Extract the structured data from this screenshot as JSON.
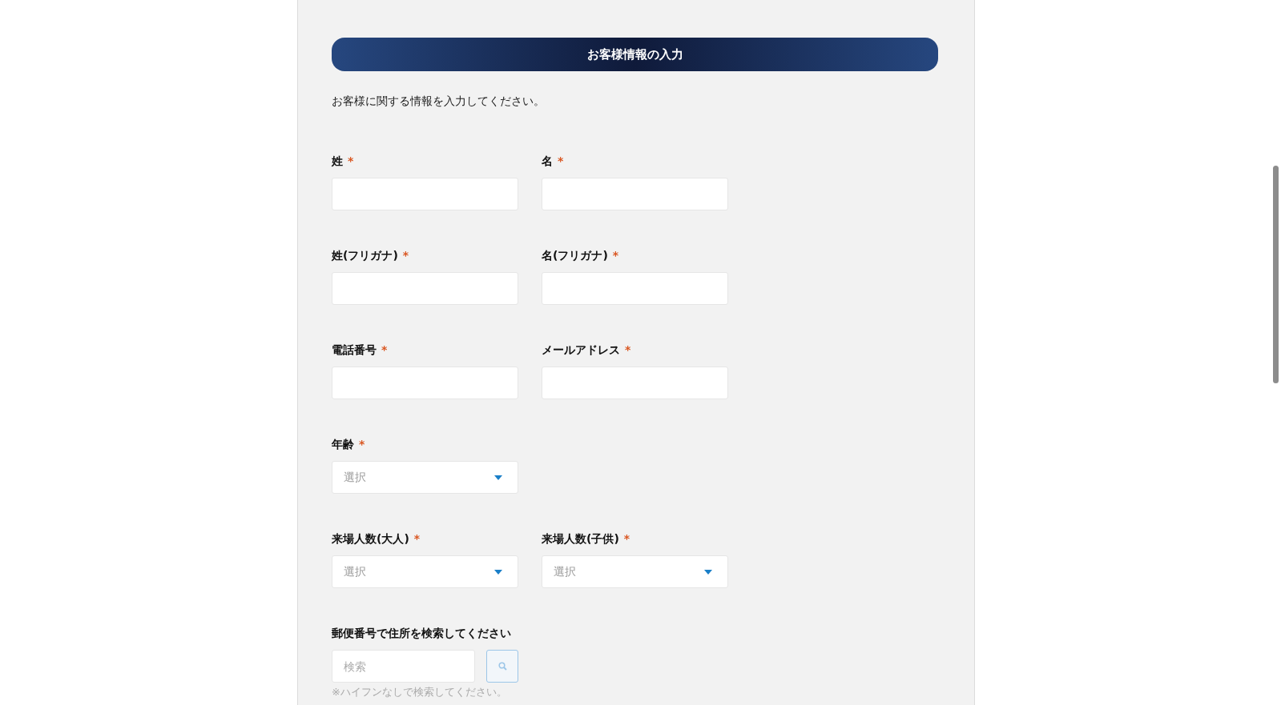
{
  "header": {
    "title": "お客様情報の入力"
  },
  "intro": "お客様に関する情報を入力してください。",
  "rows": [
    {
      "fields": [
        {
          "kind": "text",
          "label": "姓",
          "required": true
        },
        {
          "kind": "text",
          "label": "名",
          "required": true
        }
      ]
    },
    {
      "fields": [
        {
          "kind": "text",
          "label": "姓(フリガナ)",
          "required": true
        },
        {
          "kind": "text",
          "label": "名(フリガナ)",
          "required": true
        }
      ]
    },
    {
      "fields": [
        {
          "kind": "text",
          "label": "電話番号",
          "required": true
        },
        {
          "kind": "text",
          "label": "メールアドレス",
          "required": true
        }
      ]
    },
    {
      "fields": [
        {
          "kind": "select",
          "label": "年齢",
          "required": true,
          "placeholder": "選択"
        }
      ]
    },
    {
      "fields": [
        {
          "kind": "select",
          "label": "来場人数(大人)",
          "required": true,
          "placeholder": "選択"
        },
        {
          "kind": "select",
          "label": "来場人数(子供)",
          "required": true,
          "placeholder": "選択"
        }
      ]
    }
  ],
  "required_mark": "*",
  "postal": {
    "label": "郵便番号で住所を検索してください",
    "placeholder": "検索",
    "hint": "※ハイフンなしで検索してください。"
  }
}
